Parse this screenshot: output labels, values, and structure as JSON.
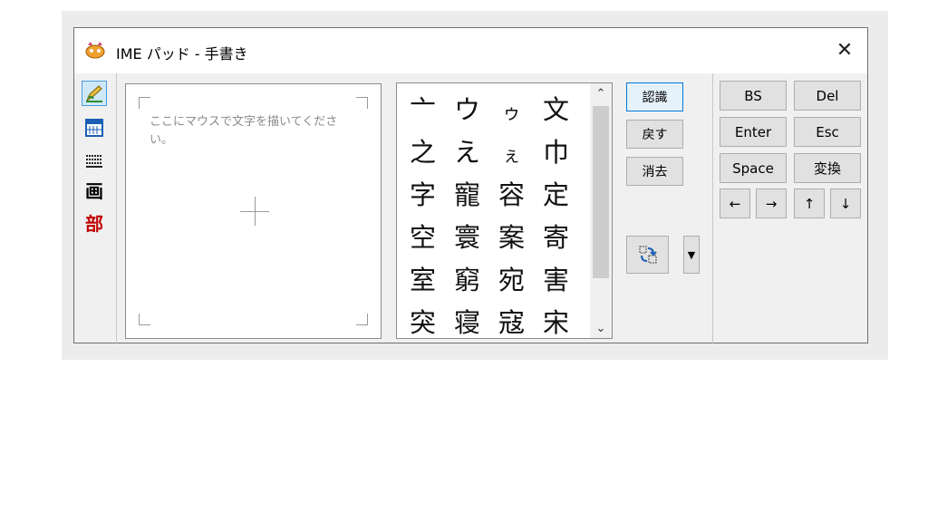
{
  "window": {
    "title": "IME パッド - 手書き",
    "close_label": "✕"
  },
  "toolbar": {
    "items": [
      {
        "name": "handwriting",
        "icon": "pencil-icon"
      },
      {
        "name": "character-list",
        "icon": "character-list-icon"
      },
      {
        "name": "soft-keyboard",
        "icon": "keyboard-icon"
      },
      {
        "name": "stroke-count",
        "label": "画"
      },
      {
        "name": "radical",
        "label": "部"
      }
    ]
  },
  "canvas": {
    "hint": "ここにマウスで文字を描いてください。"
  },
  "candidates": [
    "亠",
    "ウ",
    "ゥ",
    "文",
    "之",
    "え",
    "ぇ",
    "巾",
    "字",
    "寵",
    "容",
    "定",
    "空",
    "寰",
    "案",
    "寄",
    "室",
    "窮",
    "宛",
    "害",
    "突",
    "寝",
    "寇",
    "宋"
  ],
  "actions": {
    "recognize": "認識",
    "undo": "戻す",
    "clear": "消去"
  },
  "keys": {
    "bs": "BS",
    "del": "Del",
    "enter": "Enter",
    "esc": "Esc",
    "space": "Space",
    "convert": "変換",
    "left": "←",
    "right": "→",
    "up": "↑",
    "down": "↓"
  },
  "scroll": {
    "up": "⌃",
    "down": "⌄"
  },
  "colors": {
    "accent": "#0078d7",
    "active_tool_bg": "#cfe8f8",
    "radical_red": "#c00000"
  }
}
